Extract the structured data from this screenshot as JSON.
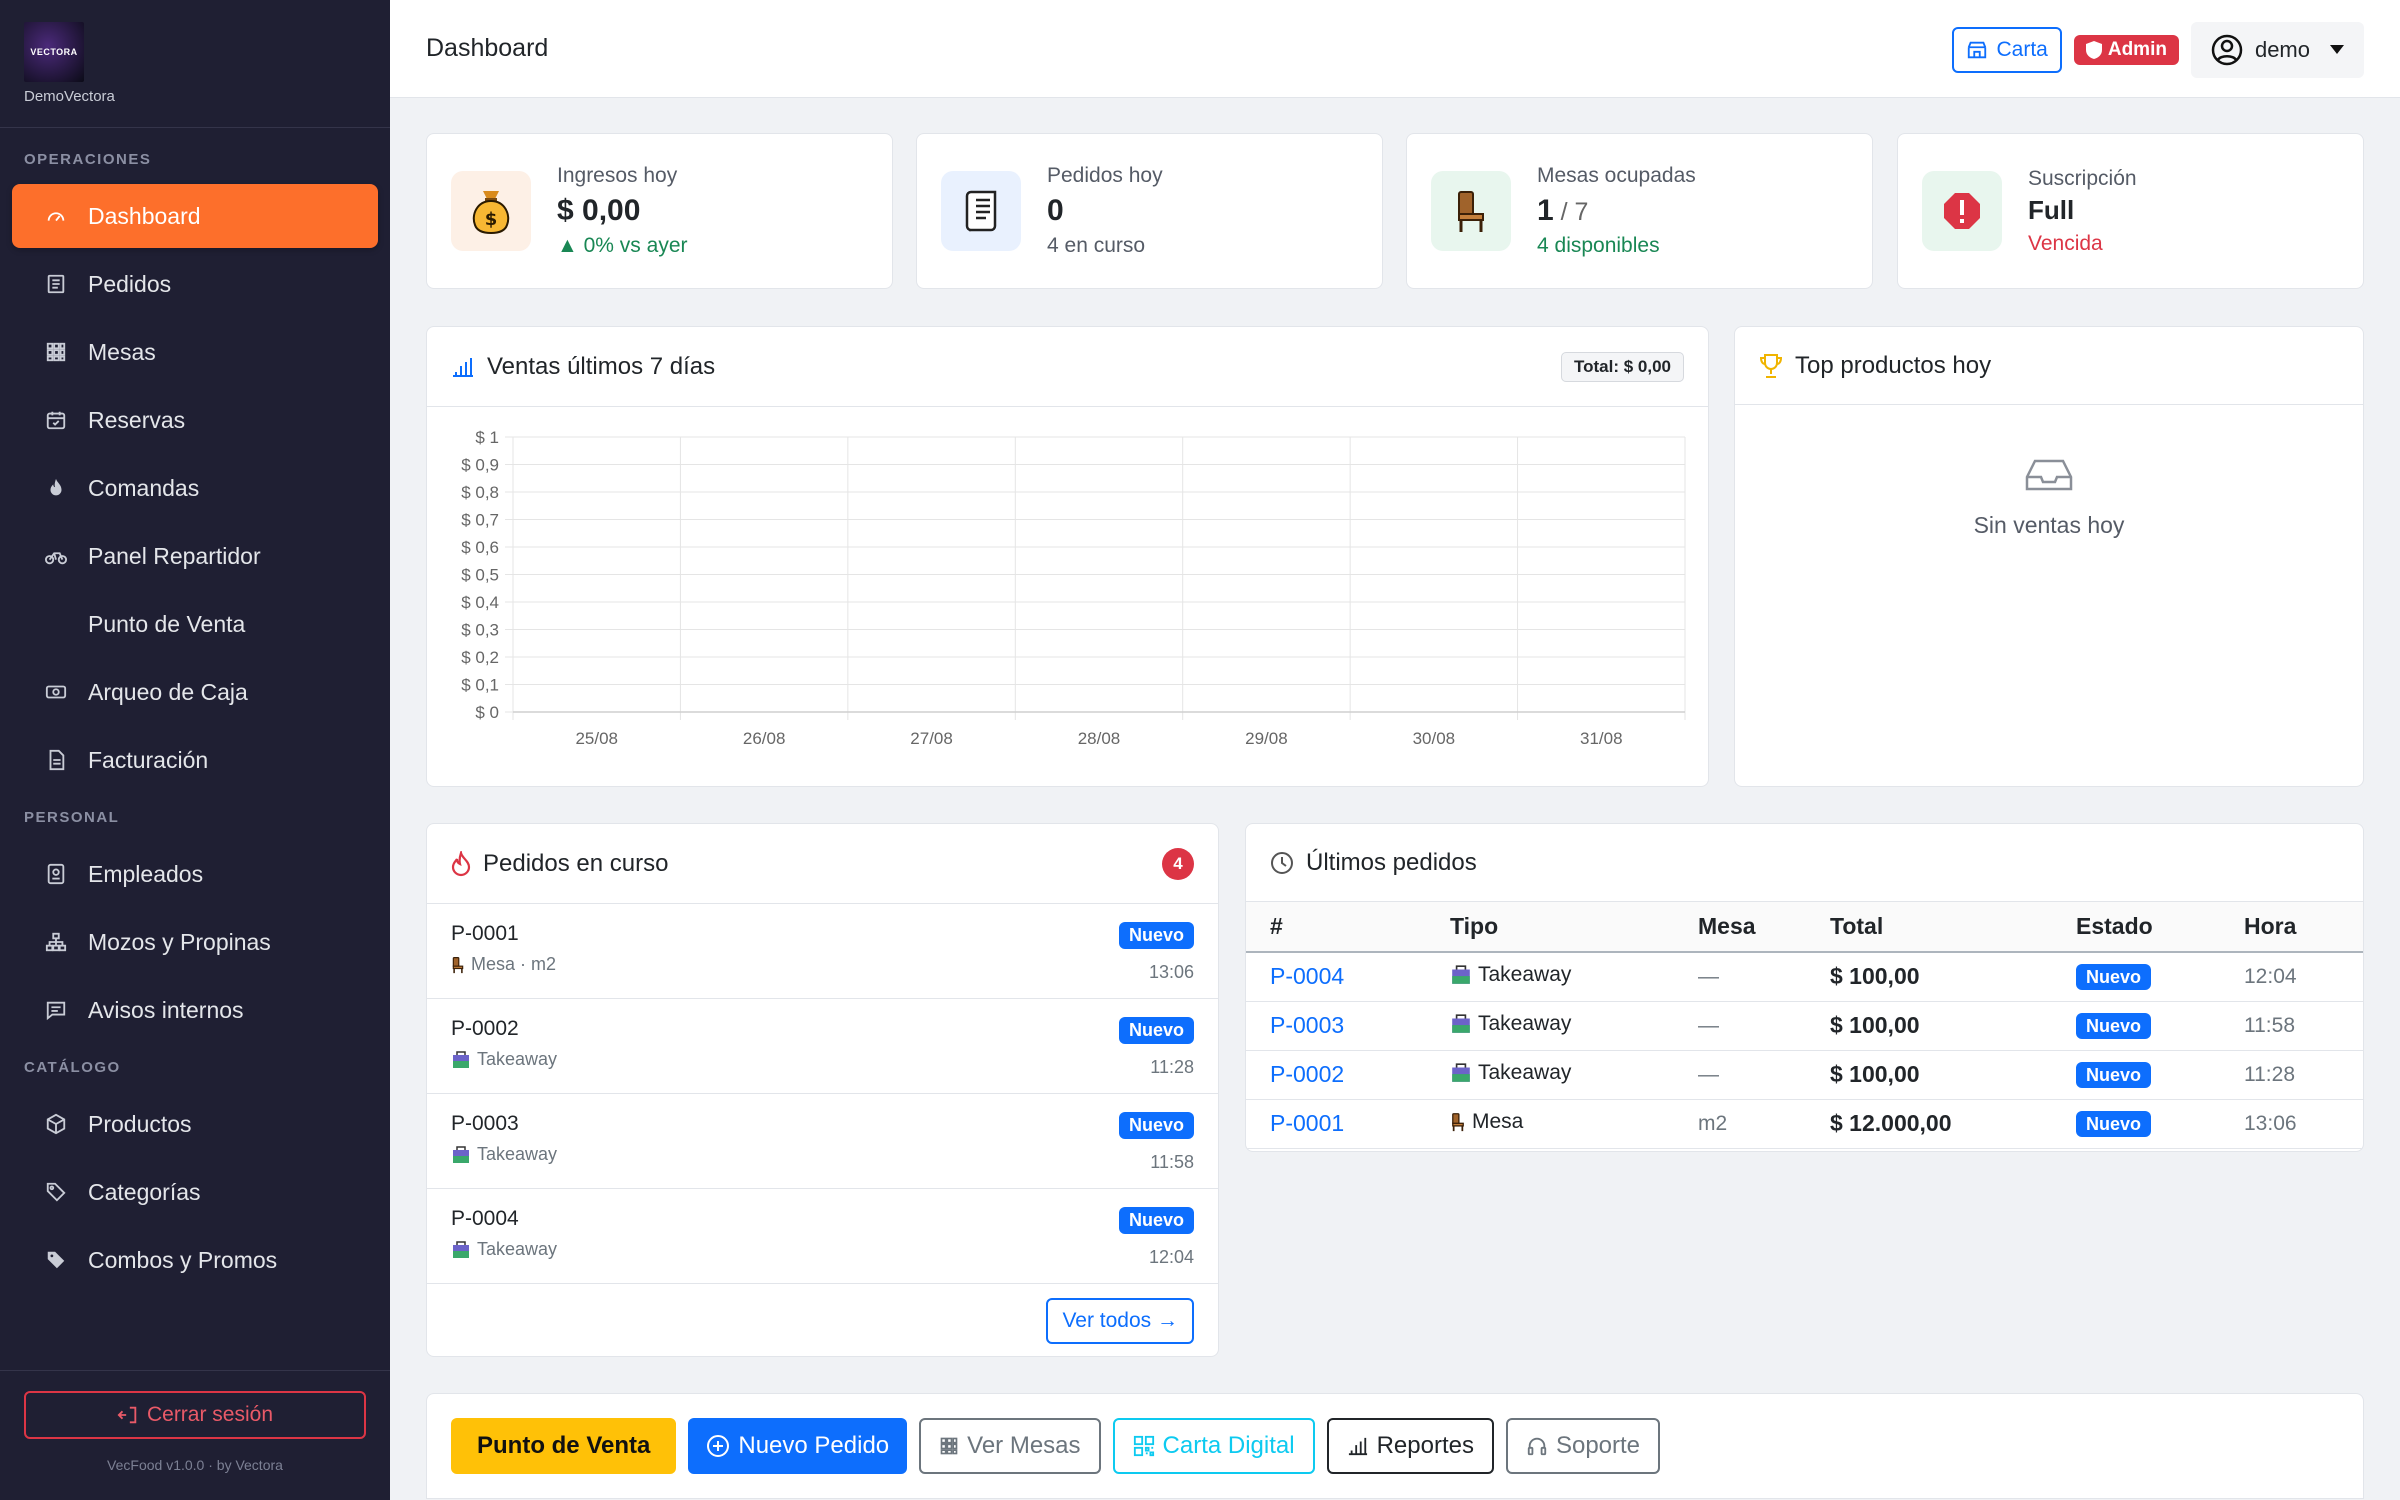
{
  "brand": {
    "logo_text": "VECTORA",
    "name": "DemoVectora"
  },
  "sidebar": {
    "sections": [
      "OPERACIONES",
      "PERSONAL",
      "CATÁLOGO"
    ],
    "items": [
      {
        "label": "Dashboard",
        "icon": "gauge-icon"
      },
      {
        "label": "Pedidos",
        "icon": "receipt-icon"
      },
      {
        "label": "Mesas",
        "icon": "grid-icon"
      },
      {
        "label": "Reservas",
        "icon": "calendar-icon"
      },
      {
        "label": "Comandas",
        "icon": "fire-icon"
      },
      {
        "label": "Panel Repartidor",
        "icon": "bicycle-icon"
      },
      {
        "label": "Punto de Venta",
        "icon": ""
      },
      {
        "label": "Arqueo de Caja",
        "icon": "cash-icon"
      },
      {
        "label": "Facturación",
        "icon": "document-icon"
      },
      {
        "label": "Empleados",
        "icon": "badge-icon"
      },
      {
        "label": "Mozos y Propinas",
        "icon": "hierarchy-icon"
      },
      {
        "label": "Avisos internos",
        "icon": "chat-icon"
      },
      {
        "label": "Productos",
        "icon": "box-icon"
      },
      {
        "label": "Categorías",
        "icon": "tags-icon"
      },
      {
        "label": "Combos y Promos",
        "icon": "tag-icon"
      }
    ],
    "logout": "Cerrar sesión",
    "version": "VecFood v1.0.0 · by Vectora"
  },
  "header": {
    "title": "Dashboard",
    "carta": "Carta",
    "admin": "Admin",
    "user": "demo"
  },
  "stats": [
    {
      "label": "Ingresos hoy",
      "value": "$ 0,00",
      "sub": "▲ 0% vs ayer",
      "icon": "money-bag-icon"
    },
    {
      "label": "Pedidos hoy",
      "value": "0",
      "sub": "4 en curso",
      "icon": "scroll-icon"
    },
    {
      "label": "Mesas ocupadas",
      "value": "1",
      "value_suffix": " / 7",
      "sub": "4 disponibles",
      "icon": "chair-icon"
    },
    {
      "label": "Suscripción",
      "value": "Full",
      "sub": "Vencida",
      "icon": "alert-icon"
    }
  ],
  "colors": {
    "accent": "#fd6f2b",
    "primary": "#0d6efd",
    "danger": "#dc3545",
    "success": "#198754",
    "warning": "#ffc107"
  },
  "sales_chart": {
    "header": "Ventas últimos 7 días",
    "total_badge": "Total: $ 0,00"
  },
  "chart_data": {
    "type": "line",
    "categories": [
      "25/08",
      "26/08",
      "27/08",
      "28/08",
      "29/08",
      "30/08",
      "31/08"
    ],
    "values": [
      0,
      0,
      0,
      0,
      0,
      0,
      0
    ],
    "ylim": [
      0,
      1
    ],
    "yticks": [
      "$ 0",
      "$ 0,1",
      "$ 0,2",
      "$ 0,3",
      "$ 0,4",
      "$ 0,5",
      "$ 0,6",
      "$ 0,7",
      "$ 0,8",
      "$ 0,9",
      "$ 1"
    ],
    "grid": true,
    "title": "",
    "xlabel": "",
    "ylabel": ""
  },
  "top_products": {
    "header": "Top productos hoy",
    "empty": "Sin ventas hoy"
  },
  "in_progress": {
    "header": "Pedidos en curso",
    "count": "4",
    "orders": [
      {
        "code": "P-0001",
        "sub": "Mesa · m2",
        "badge": "Nuevo",
        "time": "13:06",
        "icon": "chair-icon"
      },
      {
        "code": "P-0002",
        "sub": "Takeaway",
        "badge": "Nuevo",
        "time": "11:28",
        "icon": "takeaway-bag-icon"
      },
      {
        "code": "P-0003",
        "sub": "Takeaway",
        "badge": "Nuevo",
        "time": "11:58",
        "icon": "takeaway-bag-icon"
      },
      {
        "code": "P-0004",
        "sub": "Takeaway",
        "badge": "Nuevo",
        "time": "12:04",
        "icon": "takeaway-bag-icon"
      }
    ],
    "see_all": "Ver todos →"
  },
  "recent": {
    "header": "Últimos pedidos",
    "columns": [
      "#",
      "Tipo",
      "Mesa",
      "Total",
      "Estado",
      "Hora"
    ],
    "rows": [
      {
        "code": "P-0004",
        "tipo": "Takeaway",
        "mesa": "—",
        "total": "$ 100,00",
        "estado": "Nuevo",
        "hora": "12:04"
      },
      {
        "code": "P-0003",
        "tipo": "Takeaway",
        "mesa": "—",
        "total": "$ 100,00",
        "estado": "Nuevo",
        "hora": "11:58"
      },
      {
        "code": "P-0002",
        "tipo": "Takeaway",
        "mesa": "—",
        "total": "$ 100,00",
        "estado": "Nuevo",
        "hora": "11:28"
      },
      {
        "code": "P-0001",
        "tipo": "Mesa",
        "mesa": "m2",
        "total": "$ 12.000,00",
        "estado": "Nuevo",
        "hora": "13:06"
      }
    ]
  },
  "quick_actions": [
    "Punto de Venta",
    "Nuevo Pedido",
    "Ver Mesas",
    "Carta Digital",
    "Reportes",
    "Soporte"
  ]
}
